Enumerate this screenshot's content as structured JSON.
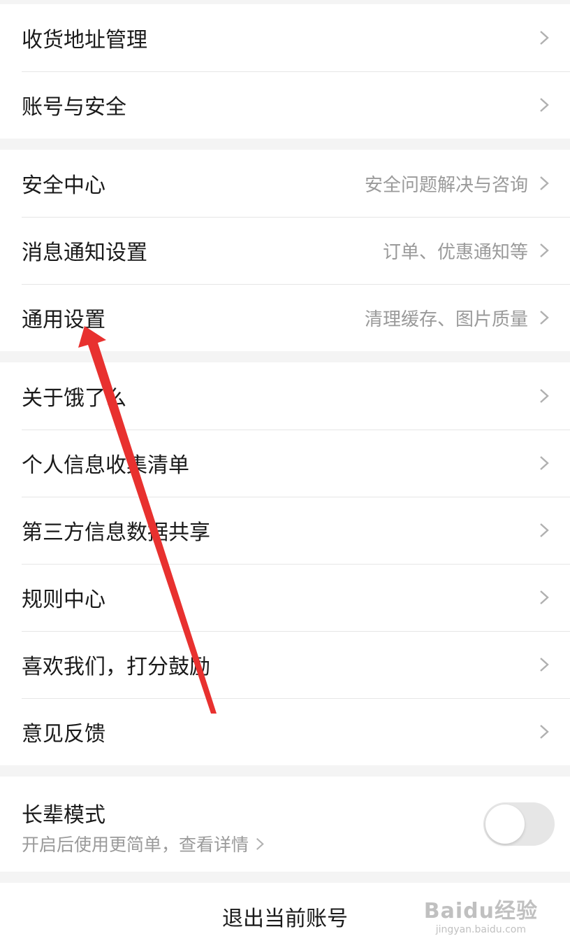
{
  "group1": [
    {
      "label": "收货地址管理"
    },
    {
      "label": "账号与安全"
    }
  ],
  "group2": [
    {
      "label": "安全中心",
      "sub": "安全问题解决与咨询"
    },
    {
      "label": "消息通知设置",
      "sub": "订单、优惠通知等"
    },
    {
      "label": "通用设置",
      "sub": "清理缓存、图片质量"
    }
  ],
  "group3": [
    {
      "label": "关于饿了么"
    },
    {
      "label": "个人信息收集清单"
    },
    {
      "label": "第三方信息数据共享"
    },
    {
      "label": "规则中心"
    },
    {
      "label": "喜欢我们，打分鼓励"
    },
    {
      "label": "意见反馈"
    }
  ],
  "elder_mode": {
    "title": "长辈模式",
    "desc": "开启后使用更简单，查看详情",
    "enabled": false
  },
  "logout_label": "退出当前账号",
  "watermark": {
    "logo": "Baidu经验",
    "url": "jingyan.baidu.com"
  },
  "colors": {
    "annotation_arrow": "#e8312f",
    "text_primary": "#1a1a1a",
    "text_secondary": "#9a9a9a"
  },
  "icons": {
    "row_chevron": "chevron-right-icon"
  }
}
